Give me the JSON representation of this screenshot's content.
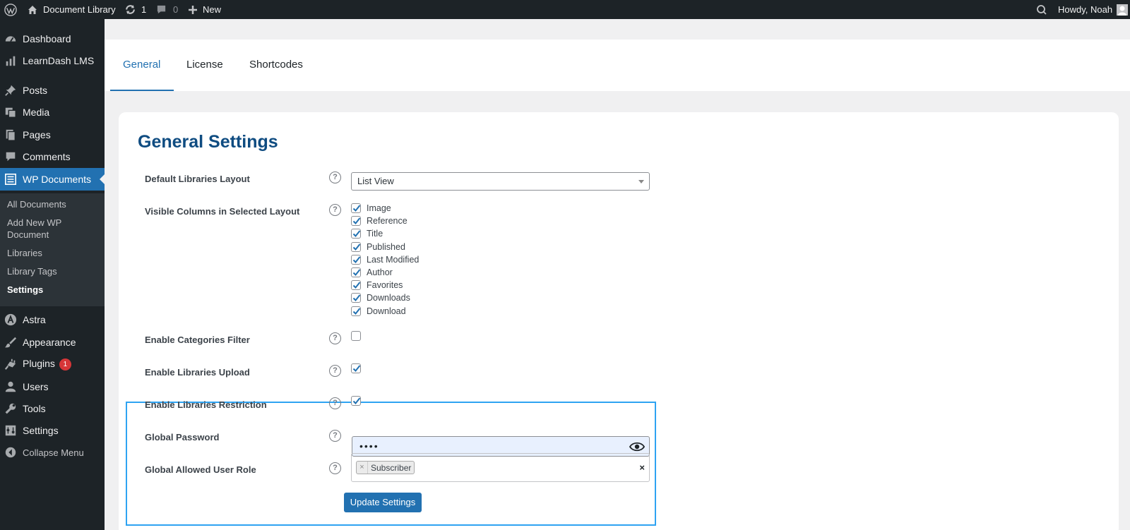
{
  "adminbar": {
    "site_name": "Document Library",
    "updates_count": "1",
    "comments_count": "0",
    "new_label": "New",
    "greeting": "Howdy, Noah"
  },
  "sidebar": {
    "items": [
      {
        "label": "Dashboard",
        "icon": "dashboard-icon"
      },
      {
        "label": "LearnDash LMS",
        "icon": "chart-bar-icon"
      },
      {
        "label": "Posts",
        "icon": "pin-icon"
      },
      {
        "label": "Media",
        "icon": "media-icon"
      },
      {
        "label": "Pages",
        "icon": "pages-icon"
      },
      {
        "label": "Comments",
        "icon": "comment-icon"
      },
      {
        "label": "WP Documents",
        "icon": "list-icon"
      },
      {
        "label": "Astra",
        "icon": "astra-icon"
      },
      {
        "label": "Appearance",
        "icon": "brush-icon"
      },
      {
        "label": "Plugins",
        "icon": "plug-icon",
        "badge": "1"
      },
      {
        "label": "Users",
        "icon": "user-icon"
      },
      {
        "label": "Tools",
        "icon": "wrench-icon"
      },
      {
        "label": "Settings",
        "icon": "settings-icon"
      },
      {
        "label": "Collapse Menu",
        "icon": "collapse-icon"
      }
    ],
    "submenu": [
      {
        "label": "All Documents"
      },
      {
        "label": "Add New WP Document"
      },
      {
        "label": "Libraries"
      },
      {
        "label": "Library Tags"
      },
      {
        "label": "Settings"
      }
    ]
  },
  "tabs": [
    {
      "label": "General"
    },
    {
      "label": "License"
    },
    {
      "label": "Shortcodes"
    }
  ],
  "settings": {
    "title": "General Settings",
    "layout_label": "Default Libraries Layout",
    "layout_value": "List View",
    "columns_label": "Visible Columns in Selected Layout",
    "columns": [
      "Image",
      "Reference",
      "Title",
      "Published",
      "Last Modified",
      "Author",
      "Favorites",
      "Downloads",
      "Download"
    ],
    "categories_label": "Enable Categories Filter",
    "upload_label": "Enable Libraries Upload",
    "restriction_label": "Enable Libraries Restriction",
    "password_label": "Global Password",
    "password_value": "••••",
    "role_label": "Global Allowed User Role",
    "role_tag": "Subscriber",
    "role_tag_remove": "×",
    "role_clear": "×",
    "help_glyph": "?",
    "submit_label": "Update Settings"
  },
  "colors": {
    "accent": "#2271b1",
    "highlight_border": "#2ea3f2",
    "title": "#0f4c81"
  }
}
